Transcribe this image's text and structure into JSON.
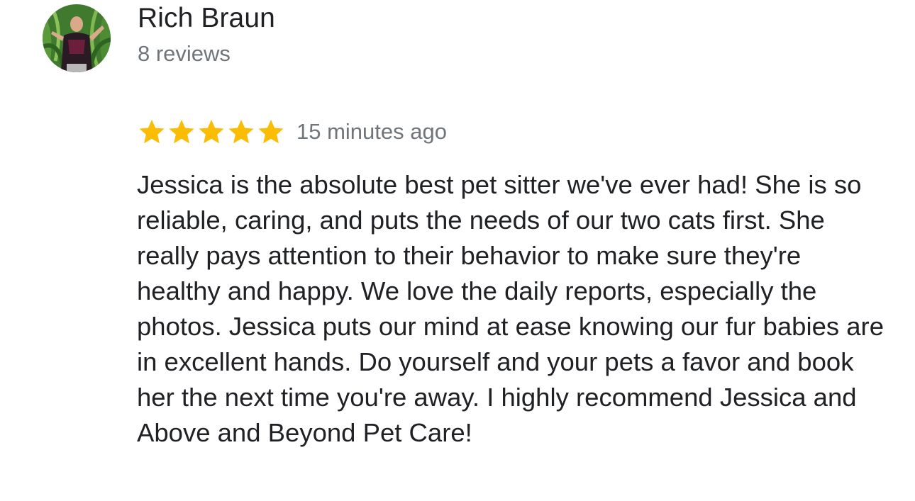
{
  "reviewer": {
    "name": "Rich Braun",
    "review_count": "8 reviews",
    "avatar_icon": "reviewer-photo"
  },
  "review": {
    "rating": 5,
    "rating_max": 5,
    "star_color": "#fbbc04",
    "timestamp": "15 minutes ago",
    "text": "Jessica is the absolute best pet sitter we've ever had! She is so reliable, caring, and puts the needs of our two cats first. She really pays attention to their behavior to make sure they're healthy and happy. We love the daily reports, especially the photos. Jessica puts our mind at ease knowing our fur babies are in excellent hands. Do yourself and your pets a favor and book her the next time you're away. I highly recommend Jessica and Above and Beyond Pet Care!"
  }
}
